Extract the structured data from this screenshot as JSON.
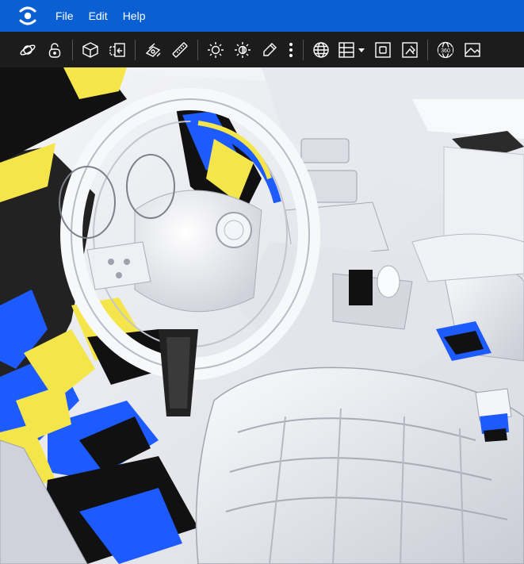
{
  "menubar": {
    "logo_icon": "eye-logo-icon",
    "items": [
      {
        "label": "File"
      },
      {
        "label": "Edit"
      },
      {
        "label": "Help"
      }
    ]
  },
  "toolbar": {
    "groups": [
      [
        "orbit-icon",
        "lock-icon"
      ],
      [
        "cube-icon",
        "section-box-icon"
      ],
      [
        "explode-icon",
        "measure-icon"
      ],
      [
        "brightness-low-icon",
        "brightness-high-icon",
        "eyedropper-icon",
        "more-vertical-icon"
      ],
      [
        "globe-icon",
        "grid-layout-dropdown-icon",
        "frame-icon",
        "image-frame-icon"
      ],
      [
        "view-360-icon",
        "image-icon"
      ]
    ],
    "badge_360": "360"
  },
  "viewport": {
    "description_colors": {
      "blue": "#1e5bff",
      "yellow": "#f4e64a",
      "black": "#111111",
      "surface": "#eceef2"
    }
  }
}
